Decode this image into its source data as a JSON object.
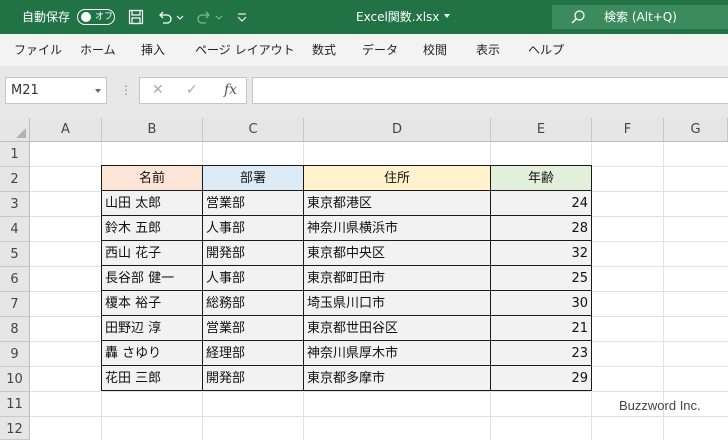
{
  "titlebar": {
    "autosave_label": "自動保存",
    "autosave_state": "オフ",
    "file_title": "Excel関数.xlsx",
    "search_label": "検索 (Alt+Q)"
  },
  "ribbon": {
    "tabs": [
      "ファイル",
      "ホーム",
      "挿入",
      "ページ レイアウト",
      "数式",
      "データ",
      "校閲",
      "表示",
      "ヘルプ"
    ]
  },
  "formula_bar": {
    "name_box": "M21",
    "fx_label": "fx",
    "value": ""
  },
  "grid": {
    "columns": [
      "A",
      "B",
      "C",
      "D",
      "E",
      "F",
      "G"
    ],
    "rows": [
      "1",
      "2",
      "3",
      "4",
      "5",
      "6",
      "7",
      "8",
      "9",
      "10",
      "11",
      "12"
    ]
  },
  "table": {
    "headers": [
      "名前",
      "部署",
      "住所",
      "年齢"
    ],
    "header_colors": [
      "#fce4d6",
      "#ddebf7",
      "#fff2cc",
      "#e2efda"
    ],
    "rows": [
      [
        "山田 太郎",
        "営業部",
        "東京都港区",
        "24"
      ],
      [
        "鈴木 五郎",
        "人事部",
        "神奈川県横浜市",
        "28"
      ],
      [
        "西山 花子",
        "開発部",
        "東京都中央区",
        "32"
      ],
      [
        "長谷部 健一",
        "人事部",
        "東京都町田市",
        "25"
      ],
      [
        "榎本 裕子",
        "総務部",
        "埼玉県川口市",
        "30"
      ],
      [
        "田野辺 淳",
        "営業部",
        "東京都世田谷区",
        "21"
      ],
      [
        "轟 さゆり",
        "経理部",
        "神奈川県厚木市",
        "23"
      ],
      [
        "花田 三郎",
        "開発部",
        "東京都多摩市",
        "29"
      ]
    ]
  },
  "watermark": "Buzzword Inc.",
  "colors": {
    "titlebar": "#217346",
    "ribbon": "#f3f3f3",
    "header_bg": "#e6e6e6",
    "table_body": "#f2f2f2"
  }
}
